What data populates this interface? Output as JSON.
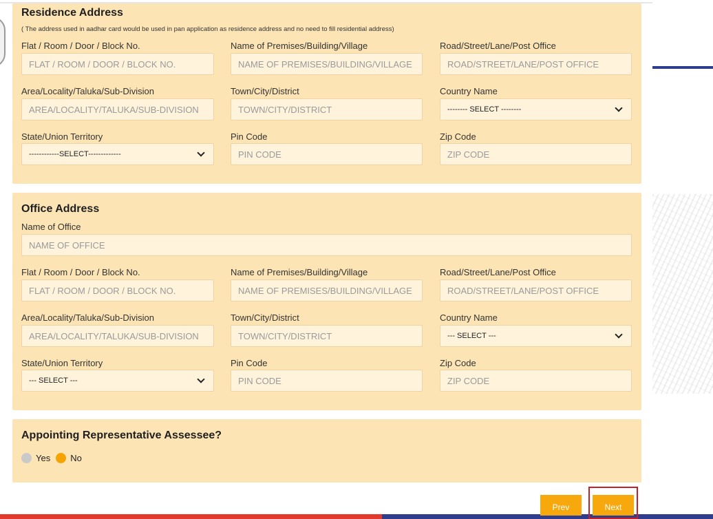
{
  "residence": {
    "title": "Residence Address",
    "note": "( The address used in aadhar card would be used in pan application as residence address and no need to fill residential address)",
    "flat_label": "Flat / Room / Door / Block No.",
    "flat_placeholder": "FLAT / ROOM / DOOR / BLOCK NO.",
    "premises_label": "Name of Premises/Building/Village",
    "premises_placeholder": "NAME OF PREMISES/BUILDING/VILLAGE",
    "road_label": "Road/Street/Lane/Post Office",
    "road_placeholder": "ROAD/STREET/LANE/POST OFFICE",
    "area_label": "Area/Locality/Taluka/Sub-Division",
    "area_placeholder": "AREA/LOCALITY/TALUKA/SUB-DIVISION",
    "town_label": "Town/City/District",
    "town_placeholder": "TOWN/CITY/DISTRICT",
    "country_label": "Country Name",
    "country_value": "-------- SELECT --------",
    "state_label": "State/Union Territory",
    "state_value": "------------SELECT-------------",
    "pin_label": "Pin Code",
    "pin_placeholder": "PIN CODE",
    "zip_label": "Zip Code",
    "zip_placeholder": "ZIP CODE"
  },
  "office": {
    "title": "Office Address",
    "name_label": "Name of Office",
    "name_placeholder": "NAME OF OFFICE",
    "flat_label": "Flat / Room / Door / Block No.",
    "flat_placeholder": "FLAT / ROOM / DOOR / BLOCK NO.",
    "premises_label": "Name of Premises/Building/Village",
    "premises_placeholder": "NAME OF PREMISES/BUILDING/VILLAGE",
    "road_label": "Road/Street/Lane/Post Office",
    "road_placeholder": "ROAD/STREET/LANE/POST OFFICE",
    "area_label": "Area/Locality/Taluka/Sub-Division",
    "area_placeholder": "AREA/LOCALITY/TALUKA/SUB-DIVISION",
    "town_label": "Town/City/District",
    "town_placeholder": "TOWN/CITY/DISTRICT",
    "country_label": "Country Name",
    "country_value": "--- SELECT ---",
    "state_label": "State/Union Territory",
    "state_value": "--- SELECT ---",
    "pin_label": "Pin Code",
    "pin_placeholder": "PIN CODE",
    "zip_label": "Zip Code",
    "zip_placeholder": "ZIP CODE"
  },
  "representative": {
    "title": "Appointing Representative Assessee?",
    "yes_label": "Yes",
    "no_label": "No",
    "selected": "No"
  },
  "buttons": {
    "prev": "Prev",
    "next": "Next"
  },
  "colors": {
    "section_bg": "#fce4b5",
    "accent": "#f7a80c",
    "highlight": "#c4202b",
    "bar_red": "#e33a2e",
    "bar_blue": "#2f3d8f"
  }
}
